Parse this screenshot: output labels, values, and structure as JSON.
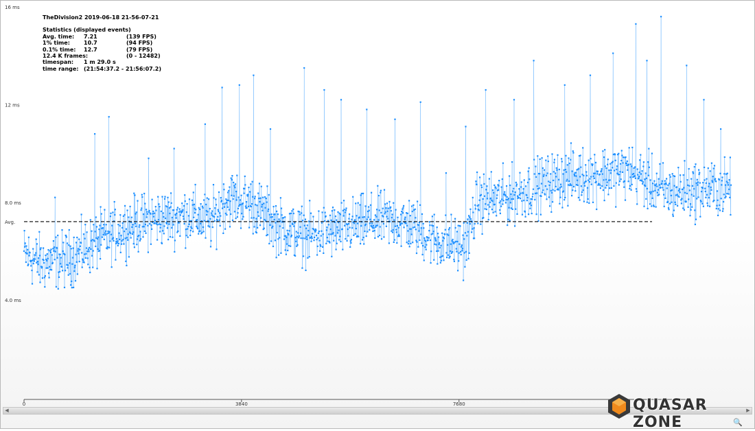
{
  "stats": {
    "title": "TheDivision2 2019-06-18 21-56-07-21",
    "heading": "Statistics (displayed events)",
    "rows": [
      {
        "label": "Avg. time:",
        "value": "7.21",
        "extra": "(139 FPS)"
      },
      {
        "label": "1% time:",
        "value": "10.7",
        "extra": "(94 FPS)"
      },
      {
        "label": "0.1% time:",
        "value": "12.7",
        "extra": "(79 FPS)"
      },
      {
        "label": "12.4 K frames:",
        "value": "",
        "extra": "(0 - 12482)"
      },
      {
        "label": "timespan:",
        "value": "1 m 29.0 s",
        "extra": ""
      },
      {
        "label": "time range:",
        "value": "(21:54:37.2 - 21:56:07.2)",
        "extra": ""
      }
    ]
  },
  "logo": {
    "text": "QUASAR ZONE"
  },
  "chart_data": {
    "type": "scatter",
    "title": "TheDivision2 2019-06-18 21-56-07-21",
    "xlabel": "",
    "ylabel": "",
    "xlim": [
      0,
      12482
    ],
    "ylim": [
      3.5,
      16
    ],
    "y_ticks": [
      {
        "value": 16,
        "label": "16 ms"
      },
      {
        "value": 12,
        "label": "12 ms"
      },
      {
        "value": 8,
        "label": "8.0 ms"
      },
      {
        "value": 4,
        "label": "4.0 ms"
      }
    ],
    "x_ticks": [
      {
        "value": 0,
        "label": "0"
      },
      {
        "value": 3840,
        "label": "3840"
      },
      {
        "value": 7680,
        "label": "7680"
      }
    ],
    "avg_line": {
      "value": 7.21,
      "label": "Avg."
    },
    "series_color": "#1e90ff",
    "trend": [
      {
        "x": 0,
        "y": 5.9
      },
      {
        "x": 300,
        "y": 5.5
      },
      {
        "x": 800,
        "y": 5.7
      },
      {
        "x": 1300,
        "y": 6.4
      },
      {
        "x": 1800,
        "y": 7.0
      },
      {
        "x": 2300,
        "y": 7.3
      },
      {
        "x": 2900,
        "y": 7.5
      },
      {
        "x": 3300,
        "y": 7.2
      },
      {
        "x": 3600,
        "y": 8.2
      },
      {
        "x": 4000,
        "y": 8.0
      },
      {
        "x": 4500,
        "y": 7.0
      },
      {
        "x": 5000,
        "y": 6.6
      },
      {
        "x": 5600,
        "y": 6.9
      },
      {
        "x": 6300,
        "y": 7.3
      },
      {
        "x": 6800,
        "y": 7.1
      },
      {
        "x": 7300,
        "y": 6.4
      },
      {
        "x": 7800,
        "y": 6.2
      },
      {
        "x": 8000,
        "y": 8.0
      },
      {
        "x": 8500,
        "y": 8.2
      },
      {
        "x": 9000,
        "y": 8.6
      },
      {
        "x": 9500,
        "y": 9.0
      },
      {
        "x": 10000,
        "y": 9.1
      },
      {
        "x": 10700,
        "y": 9.3
      },
      {
        "x": 11300,
        "y": 8.4
      },
      {
        "x": 11800,
        "y": 8.5
      },
      {
        "x": 12482,
        "y": 8.6
      }
    ],
    "spikes": [
      {
        "x": 550,
        "y": 8.2
      },
      {
        "x": 1250,
        "y": 10.8
      },
      {
        "x": 1500,
        "y": 11.5
      },
      {
        "x": 2200,
        "y": 9.8
      },
      {
        "x": 2650,
        "y": 10.2
      },
      {
        "x": 3200,
        "y": 11.2
      },
      {
        "x": 3500,
        "y": 12.7
      },
      {
        "x": 3800,
        "y": 12.8
      },
      {
        "x": 4050,
        "y": 13.2
      },
      {
        "x": 4350,
        "y": 11.0
      },
      {
        "x": 4950,
        "y": 13.5
      },
      {
        "x": 5300,
        "y": 12.6
      },
      {
        "x": 5600,
        "y": 12.2
      },
      {
        "x": 6050,
        "y": 11.8
      },
      {
        "x": 6550,
        "y": 11.4
      },
      {
        "x": 7000,
        "y": 12.1
      },
      {
        "x": 7450,
        "y": 9.2
      },
      {
        "x": 7800,
        "y": 11.1
      },
      {
        "x": 8150,
        "y": 12.6
      },
      {
        "x": 8650,
        "y": 12.2
      },
      {
        "x": 9000,
        "y": 13.8
      },
      {
        "x": 9550,
        "y": 12.8
      },
      {
        "x": 10000,
        "y": 13.2
      },
      {
        "x": 10400,
        "y": 14.1
      },
      {
        "x": 10800,
        "y": 15.3
      },
      {
        "x": 11000,
        "y": 13.8
      },
      {
        "x": 11250,
        "y": 15.6
      },
      {
        "x": 11700,
        "y": 13.6
      },
      {
        "x": 12000,
        "y": 12.2
      },
      {
        "x": 12300,
        "y": 11.0
      }
    ],
    "noise_amplitude_ms": 0.7,
    "grid": false,
    "legend": "none"
  }
}
